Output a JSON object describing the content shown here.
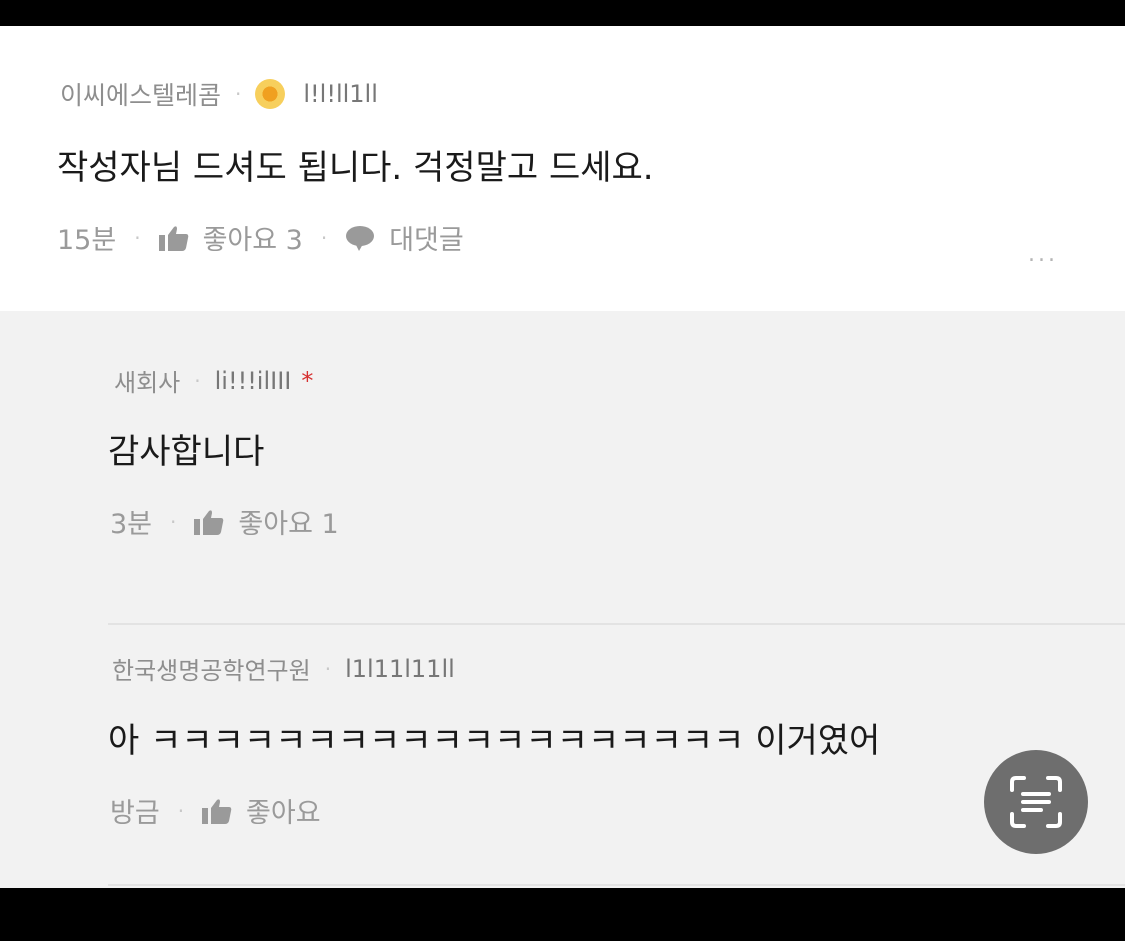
{
  "main_comment": {
    "author": "이씨에스텔레콤",
    "handle": "l!l!ll1ll",
    "text": "작성자님 드셔도 됩니다. 걱정말고 드세요.",
    "time": "15분",
    "like_label": "좋아요 3",
    "reply_label": "대댓글",
    "more": "..."
  },
  "replies": [
    {
      "author": "새회사",
      "handle": "li!!!ilIII",
      "text": "감사합니다",
      "time": "3분",
      "like_label": "좋아요 1"
    },
    {
      "author": "한국생명공학연구원",
      "handle": "l1l11l11ll",
      "text": "아 ㅋㅋㅋㅋㅋㅋㅋㅋㅋㅋㅋㅋㅋㅋㅋㅋㅋㅋㅋ 이거였어",
      "time": "방금",
      "like_label": "좋아요"
    }
  ],
  "colors": {
    "meta": "#8e8e8e",
    "text": "#1a1a1a",
    "reply_bg": "#f2f2f2",
    "author_star": "#d63030",
    "scan_button": "#6e6e6e"
  },
  "icons": [
    "thumbs-up-icon",
    "speech-bubble-icon",
    "more-dots-icon",
    "scan-text-icon"
  ]
}
